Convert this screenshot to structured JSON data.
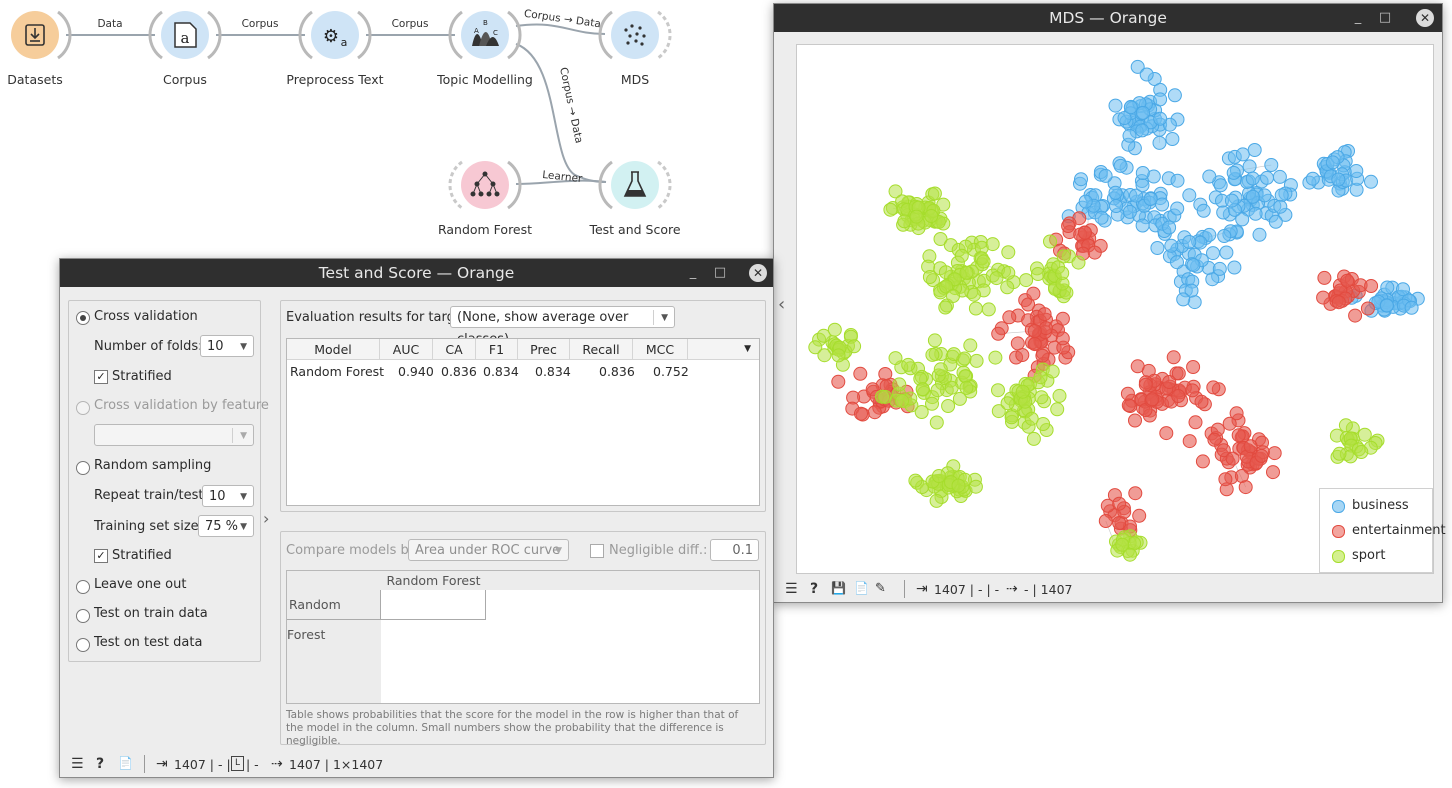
{
  "workflow": {
    "nodes": [
      {
        "id": "datasets",
        "label": "Datasets"
      },
      {
        "id": "corpus",
        "label": "Corpus"
      },
      {
        "id": "preprocess",
        "label": "Preprocess Text"
      },
      {
        "id": "topic",
        "label": "Topic Modelling"
      },
      {
        "id": "mds",
        "label": "MDS"
      },
      {
        "id": "rf",
        "label": "Random Forest"
      },
      {
        "id": "testscore",
        "label": "Test and Score"
      }
    ],
    "links": {
      "datasets_corpus": "Data",
      "corpus_preprocess": "Corpus",
      "preprocess_topic": "Corpus",
      "topic_mds": "Corpus → Data",
      "topic_testscore": "Corpus → Data",
      "rf_testscore": "Learner"
    }
  },
  "testscore": {
    "title": "Test and Score — Orange",
    "sampling": {
      "cross_validation": "Cross validation",
      "number_of_folds_label": "Number of folds:",
      "number_of_folds_value": "10",
      "stratified_label": "Stratified",
      "cv_by_feature": "Cross validation by feature",
      "random_sampling": "Random sampling",
      "repeat_label": "Repeat train/test:",
      "repeat_value": "10",
      "training_size_label": "Training set size:",
      "training_size_value": "75 %",
      "stratified2_label": "Stratified",
      "leave_one_out": "Leave one out",
      "test_on_train": "Test on train data",
      "test_on_test": "Test on test data",
      "selected": "cross_validation"
    },
    "target_label": "Evaluation results for target",
    "target_value": "(None, show average over classes)",
    "results": {
      "headers": [
        "Model",
        "AUC",
        "CA",
        "F1",
        "Prec",
        "Recall",
        "MCC"
      ],
      "rows": [
        [
          "Random Forest",
          "0.940",
          "0.836",
          "0.834",
          "0.834",
          "0.836",
          "0.752"
        ]
      ]
    },
    "compare": {
      "label": "Compare models by:",
      "value": "Area under ROC curve",
      "negligible_label": "Negligible diff.:",
      "negligible_value": "0.1",
      "column_header": "Random Forest",
      "row_header": "Random Forest",
      "note": "Table shows probabilities that the score for the model in the row is higher than that of the model in the column. Small numbers show the probability that the difference is negligible."
    },
    "status": {
      "input": "1407 | - | ",
      "input2": " | -",
      "output": "1407 | 1×1407"
    }
  },
  "mds": {
    "title": "MDS — Orange",
    "legend": [
      {
        "label": "business",
        "color": "#4aa8e6"
      },
      {
        "label": "entertainment",
        "color": "#e24a3f"
      },
      {
        "label": "sport",
        "color": "#a6dd2c"
      }
    ],
    "status": {
      "input": "1407 | - | -",
      "output": "- | 1407"
    }
  },
  "icons": {
    "window_minimize": "_",
    "window_maximize": "□",
    "window_close": "✕",
    "hamburger": "☰",
    "help": "?",
    "report": "📄",
    "save": "💾",
    "input": "⇥",
    "output": "⇢",
    "collapse": "‹",
    "expand": "›"
  },
  "colors": {
    "business": "#4aa8e6",
    "entertainment": "#e24a3f",
    "sport": "#a6dd2c"
  }
}
